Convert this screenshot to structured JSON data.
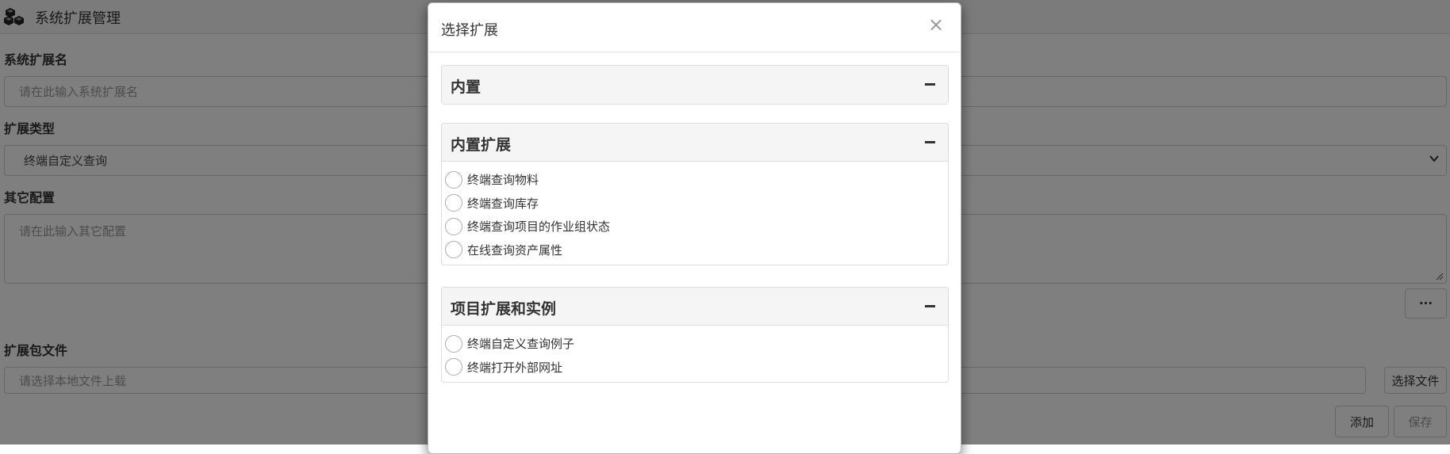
{
  "app": {
    "title": "系统扩展管理",
    "icon": "cubes-icon"
  },
  "form": {
    "name_label": "系统扩展名",
    "name_placeholder": "请在此输入系统扩展名",
    "type_label": "扩展类型",
    "type_value": "终端自定义查询",
    "config_label": "其它配置",
    "config_placeholder": "请在此输入其它配置",
    "more_button": "···",
    "file_label": "扩展包文件",
    "file_placeholder": "请选择本地文件上载",
    "choose_file_button": "选择文件",
    "add_button": "添加",
    "save_button": "保存"
  },
  "modal": {
    "title": "选择扩展",
    "close_symbol": "×",
    "groups": [
      {
        "title": "内置",
        "collapse_icon": "minus-icon",
        "items": []
      },
      {
        "title": "内置扩展",
        "collapse_icon": "minus-icon",
        "items": [
          "终端查询物料",
          "终端查询库存",
          "终端查询项目的作业组状态",
          "在线查询资产属性"
        ]
      },
      {
        "title": "项目扩展和实例",
        "collapse_icon": "minus-icon",
        "items": [
          "终端自定义查询例子",
          "终端打开外部网址"
        ]
      }
    ]
  },
  "colors": {
    "overlay": "#808080",
    "panel_heading": "#f5f5f5",
    "border": "#dddddd"
  }
}
